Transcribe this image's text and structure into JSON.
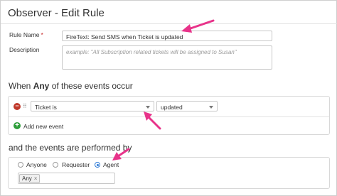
{
  "page": {
    "title": "Observer - Edit Rule"
  },
  "form": {
    "rule_name_label": "Rule Name",
    "required_mark": "*",
    "rule_name_value": "FireText: Send SMS when Ticket is updated",
    "description_label": "Description",
    "description_placeholder": "example: \"All Subscription related tickets will be assigned to Susan\""
  },
  "events": {
    "heading_pre": "When ",
    "heading_bold": "Any",
    "heading_post": " of these events occur",
    "condition_field": "Ticket is",
    "condition_value": "updated",
    "add_label": "Add new event"
  },
  "performers": {
    "heading": "and the events are performed by",
    "options": [
      "Anyone",
      "Requester",
      "Agent"
    ],
    "selected": "Agent",
    "tag_label": "Any",
    "tag_remove": "×"
  },
  "colors": {
    "accent_arrow": "#e8338a",
    "radio_selected": "#2f7bd6",
    "remove": "#c0392b",
    "add": "#2e9e3b"
  },
  "icons": {
    "remove": "minus-circle-icon",
    "drag": "drag-handle-icon",
    "add": "plus-circle-icon",
    "dropdown": "caret-down-icon"
  }
}
